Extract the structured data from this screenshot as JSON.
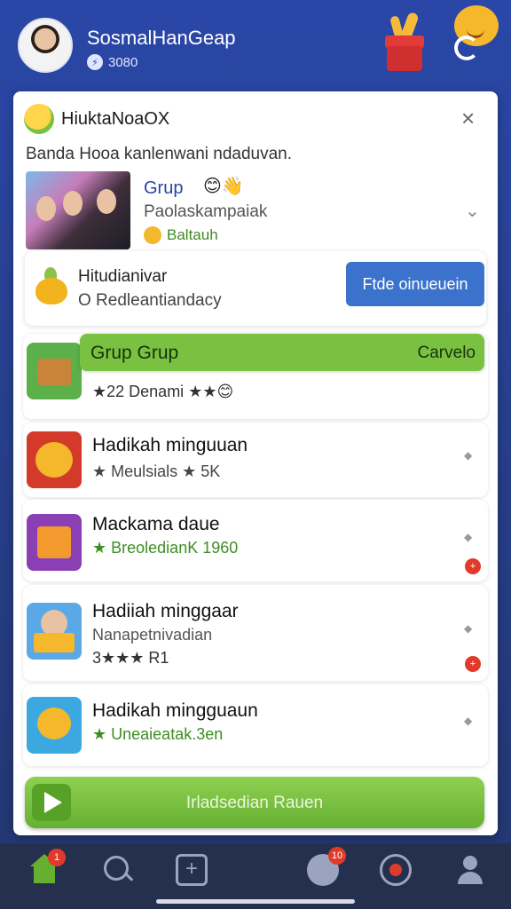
{
  "header": {
    "app_name": "SosmalHanGeap",
    "coins": "3080"
  },
  "card": {
    "title": "HiuktaNoaOX",
    "close": "×",
    "subtitle": "Banda Hooa kanlenwani ndaduvan."
  },
  "group": {
    "name": "Grup",
    "emoji": "😊👋",
    "desc": "Paolaskampaiak",
    "status": "Baltauh"
  },
  "highlight": {
    "title": "Hitudianivar",
    "desc": "O Redleantiandacy",
    "button": "Ftde oinueuein"
  },
  "items": [
    {
      "title": "Grup Grup",
      "action": "Carvelo",
      "sub": "★22 Denami ★★😊"
    },
    {
      "title": "Hadikah minguuan",
      "sub": "★ Meulsials ★ 5K"
    },
    {
      "title": "Mackama daue",
      "sub": "★ BreoledianK 1960"
    },
    {
      "title": "Hadiiah minggaar",
      "sub": "Nanapetnivadian",
      "extra": "3★★★ R1"
    },
    {
      "title": "Hadikah mingguaun",
      "sub": "★ Uneaieatak.3en"
    }
  ],
  "play": {
    "label": "Irladsedian Rauen"
  },
  "tabbar": {
    "home_badge": "1",
    "chat_badge": "10"
  },
  "colors": {
    "accent_green": "#7ac142",
    "accent_blue": "#3a72cc",
    "header_blue": "#2a47a8"
  }
}
